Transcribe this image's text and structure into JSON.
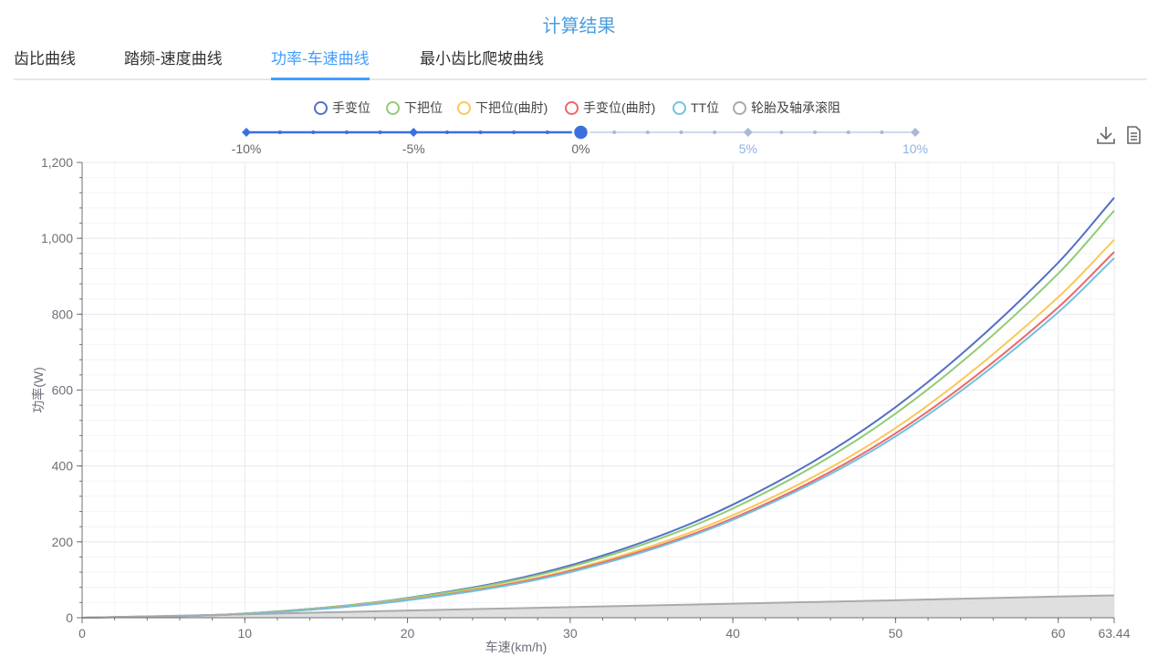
{
  "page_title": "计算结果",
  "tabs": [
    {
      "label": "齿比曲线",
      "active": false
    },
    {
      "label": "踏频-速度曲线",
      "active": false
    },
    {
      "label": "功率-车速曲线",
      "active": true
    },
    {
      "label": "最小齿比爬坡曲线",
      "active": false
    }
  ],
  "legend": [
    {
      "label": "手变位",
      "color": "#5470c6"
    },
    {
      "label": "下把位",
      "color": "#91cc75"
    },
    {
      "label": "下把位(曲肘)",
      "color": "#fac858"
    },
    {
      "label": "手变位(曲肘)",
      "color": "#ee6666"
    },
    {
      "label": "TT位",
      "color": "#73c0de"
    },
    {
      "label": "轮胎及轴承滚阻",
      "color": "#aaaaaa"
    }
  ],
  "slope_slider": {
    "labels": [
      "-10%",
      "-5%",
      "0%",
      "5%",
      "10%"
    ],
    "min": -10,
    "max": 10,
    "step": 1,
    "value": 0
  },
  "toolbox": {
    "download_icon": "download-icon",
    "data_view_icon": "data-view-icon"
  },
  "chart_data": {
    "type": "line",
    "xlabel": "车速(km/h)",
    "ylabel": "功率(W)",
    "xlim": [
      0,
      63.44
    ],
    "ylim": [
      0,
      1200
    ],
    "x_ticks": [
      "0",
      "10",
      "20",
      "30",
      "40",
      "50",
      "60",
      "63.44"
    ],
    "y_ticks": [
      "0",
      "200",
      "400",
      "600",
      "800",
      "1,000",
      "1,200"
    ],
    "x": [
      0,
      10,
      20,
      30,
      40,
      50,
      60,
      63.44
    ],
    "series": [
      {
        "name": "手变位",
        "color": "#5470c6",
        "values": [
          0,
          11,
          52,
          138,
          298,
          555,
          936,
          1107
        ]
      },
      {
        "name": "下把位",
        "color": "#91cc75",
        "values": [
          0,
          11,
          51,
          134,
          288,
          538,
          907,
          1073
        ]
      },
      {
        "name": "下把位(曲肘)",
        "color": "#fac858",
        "values": [
          0,
          10,
          48,
          126,
          270,
          500,
          845,
          996
        ]
      },
      {
        "name": "手变位(曲肘)",
        "color": "#ee6666",
        "values": [
          0,
          10,
          47,
          123,
          262,
          486,
          818,
          964
        ]
      },
      {
        "name": "TT位",
        "color": "#73c0de",
        "values": [
          0,
          10,
          46,
          120,
          258,
          478,
          805,
          948
        ]
      },
      {
        "name": "轮胎及轴承滚阻",
        "color": "#aaaaaa",
        "values": [
          0,
          9,
          19,
          28,
          37,
          46,
          56,
          59
        ],
        "area": true
      }
    ],
    "grid": true,
    "legend_position": "top-center"
  }
}
